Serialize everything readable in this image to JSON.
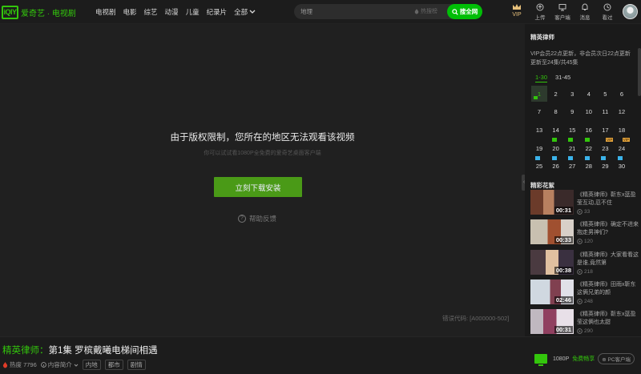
{
  "header": {
    "logo_mark": "iQIY",
    "logo_text": "爱奇艺 · 电视剧",
    "nav": [
      "电视剧",
      "电影",
      "综艺",
      "动漫",
      "儿童",
      "纪录片"
    ],
    "nav_all": "全部",
    "search": {
      "value": "",
      "placeholder": "地理",
      "hot_label": "热搜榜",
      "button": "搜全网"
    },
    "vip": "VIP",
    "tools": [
      {
        "label": "上传",
        "icon": "upload-icon"
      },
      {
        "label": "客户端",
        "icon": "monitor-icon"
      },
      {
        "label": "消息",
        "icon": "bell-icon"
      },
      {
        "label": "看过",
        "icon": "history-icon"
      }
    ],
    "brand_color": "#33c60c"
  },
  "player": {
    "message_title": "由于版权限制，您所在的地区无法观看该视频",
    "message_sub": "你可以试试看1080P全免费的爱奇艺桌面客户端",
    "download_button": "立刻下载安装",
    "feedback": "帮助反馈",
    "error_code": "错误代码: [A000000-502]"
  },
  "sidebar": {
    "title": "精英律师",
    "update_info": "VIP会员22点更新，非会员次日22点更新 更新至24集/共45集",
    "ep_tabs": [
      "1-30",
      "31-45"
    ],
    "episodes": [
      {
        "n": "1",
        "state": "current"
      },
      {
        "n": "2"
      },
      {
        "n": "3"
      },
      {
        "n": "4"
      },
      {
        "n": "5"
      },
      {
        "n": "6"
      },
      {
        "n": "7"
      },
      {
        "n": "8"
      },
      {
        "n": "9"
      },
      {
        "n": "10"
      },
      {
        "n": "11"
      },
      {
        "n": "12"
      },
      {
        "n": "13"
      },
      {
        "n": "14"
      },
      {
        "n": "15"
      },
      {
        "n": "16"
      },
      {
        "n": "17"
      },
      {
        "n": "18"
      },
      {
        "n": "19"
      },
      {
        "n": "20",
        "badge": "green"
      },
      {
        "n": "21",
        "badge": "green"
      },
      {
        "n": "22",
        "badge": "green"
      },
      {
        "n": "23",
        "badge": "vip",
        "badge_text": "VIP"
      },
      {
        "n": "24",
        "badge": "vip",
        "badge_text": "VIP"
      },
      {
        "n": "25",
        "badge": "blue"
      },
      {
        "n": "26",
        "badge": "blue"
      },
      {
        "n": "27",
        "badge": "blue"
      },
      {
        "n": "28",
        "badge": "blue"
      },
      {
        "n": "29",
        "badge": "blue"
      },
      {
        "n": "30",
        "badge": "blue"
      }
    ],
    "highlights_title": "精彩花絮",
    "clips": [
      {
        "title": "《精英律师》靳东x蓝盈莹互动,忍不住",
        "duration": "00:31",
        "views": "33"
      },
      {
        "title": "《精英律师》确定不进来抱走男神们?",
        "duration": "00:33",
        "views": "120"
      },
      {
        "title": "《精英律师》大家看看这是谁,竟然第",
        "duration": "00:38",
        "views": "218"
      },
      {
        "title": "《精英律师》田雨x靳东这俩兄弟的颜",
        "duration": "02:46",
        "views": "248"
      },
      {
        "title": "《精英律师》靳东x蓝盈莹这俩也太甜",
        "duration": "00:31",
        "views": "290"
      }
    ]
  },
  "footer": {
    "show_name": "精英律师：",
    "episode_title": "第1集 罗槟戴曦电梯间相遇",
    "heat_label": "热度 7796",
    "intro_label": "内容简介",
    "tags": [
      "内地",
      "都市",
      "剧情"
    ],
    "quality": "1080P",
    "free_label": "免费畅享",
    "pc_client": "PC客户端"
  }
}
